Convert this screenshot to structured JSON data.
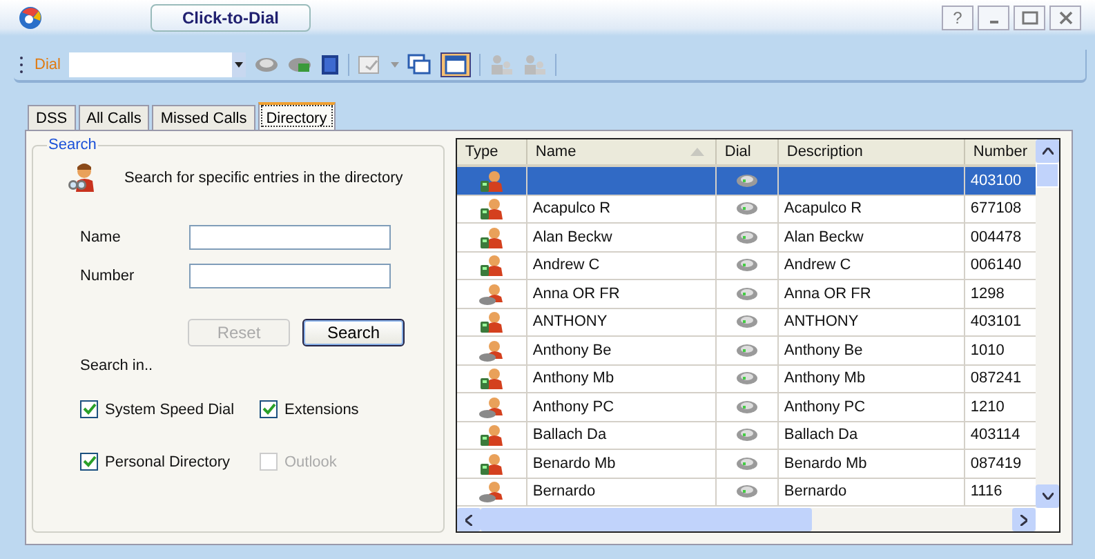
{
  "window": {
    "title": "Click-to-Dial",
    "help": "?"
  },
  "toolbar": {
    "dial_label": "Dial"
  },
  "tabs": [
    {
      "label": "DSS",
      "selected": false
    },
    {
      "label": "All Calls",
      "selected": false
    },
    {
      "label": "Missed Calls",
      "selected": false
    },
    {
      "label": "Directory",
      "selected": true
    }
  ],
  "search": {
    "group_label": "Search",
    "intro": "Search for specific entries in the directory",
    "fields": [
      {
        "label": "Name"
      },
      {
        "label": "Number"
      }
    ],
    "buttons": [
      {
        "label": "Reset",
        "disabled": true
      },
      {
        "label": "Search",
        "disabled": false
      }
    ],
    "search_in_label": "Search in..",
    "sources": [
      {
        "label": "System Speed Dial",
        "checked": true,
        "disabled": false
      },
      {
        "label": "Extensions",
        "checked": true,
        "disabled": false
      },
      {
        "label": "Personal Directory",
        "checked": true,
        "disabled": false
      },
      {
        "label": "Outlook",
        "checked": false,
        "disabled": true
      }
    ]
  },
  "table": {
    "columns": [
      {
        "label": "Type",
        "sorted": false
      },
      {
        "label": "Name",
        "sorted": true
      },
      {
        "label": "Dial",
        "sorted": false
      },
      {
        "label": "Description",
        "sorted": false
      },
      {
        "label": "Number",
        "sorted": false
      }
    ],
    "rows": [
      {
        "kind": "mobile",
        "name": "",
        "description": "",
        "number": "403100",
        "selected": true
      },
      {
        "kind": "mobile",
        "name": "Acapulco R",
        "description": "Acapulco R",
        "number": "677108",
        "selected": false
      },
      {
        "kind": "mobile",
        "name": "Alan Beckw",
        "description": "Alan Beckw",
        "number": "004478",
        "selected": false
      },
      {
        "kind": "mobile",
        "name": "Andrew C",
        "description": "Andrew C",
        "number": "006140",
        "selected": false
      },
      {
        "kind": "desk",
        "name": "Anna OR FR",
        "description": "Anna OR FR",
        "number": "1298",
        "selected": false
      },
      {
        "kind": "mobile",
        "name": "ANTHONY",
        "description": "ANTHONY",
        "number": "403101",
        "selected": false
      },
      {
        "kind": "desk",
        "name": "Anthony Be",
        "description": "Anthony Be",
        "number": "1010",
        "selected": false
      },
      {
        "kind": "mobile",
        "name": "Anthony Mb",
        "description": "Anthony Mb",
        "number": "087241",
        "selected": false
      },
      {
        "kind": "desk",
        "name": "Anthony PC",
        "description": "Anthony PC",
        "number": "1210",
        "selected": false
      },
      {
        "kind": "mobile",
        "name": "Ballach Da",
        "description": "Ballach Da",
        "number": "403114",
        "selected": false
      },
      {
        "kind": "mobile",
        "name": "Benardo Mb",
        "description": "Benardo Mb",
        "number": "087419",
        "selected": false
      },
      {
        "kind": "desk",
        "name": "Bernardo",
        "description": "Bernardo",
        "number": "1116",
        "selected": false
      }
    ]
  }
}
